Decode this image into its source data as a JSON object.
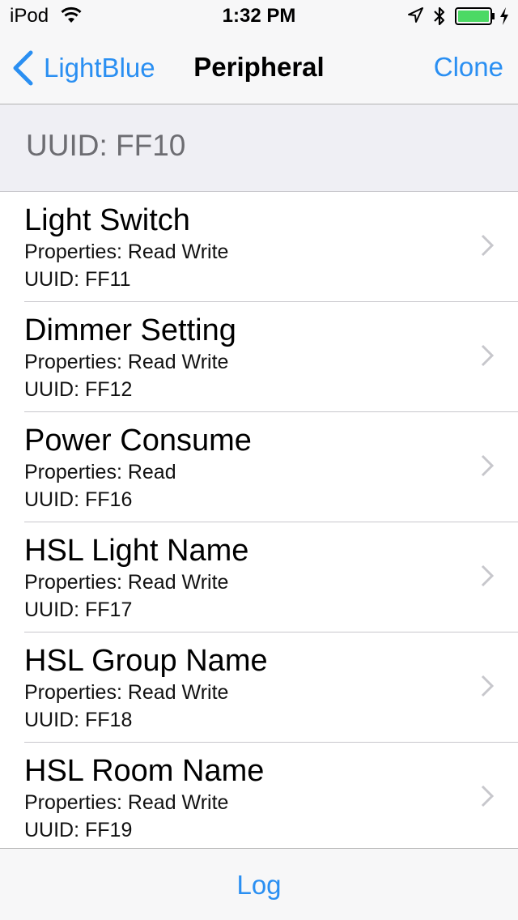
{
  "status_bar": {
    "carrier": "iPod",
    "time": "1:32 PM",
    "battery_color": "#4cd964",
    "wifi_icon": "wifi-icon",
    "location_icon": "location-arrow-icon",
    "bluetooth_icon": "bluetooth-icon",
    "battery_icon": "battery-icon",
    "charging_icon": "charging-bolt-icon"
  },
  "nav": {
    "back_label": "LightBlue",
    "title": "Peripheral",
    "clone_label": "Clone",
    "accent_color": "#2a8ff2"
  },
  "section": {
    "title": "UUID: FF10"
  },
  "characteristics": [
    {
      "name": "Light Switch",
      "properties": "Properties: Read Write",
      "uuid": "UUID: FF11"
    },
    {
      "name": "Dimmer Setting",
      "properties": "Properties: Read Write",
      "uuid": "UUID: FF12"
    },
    {
      "name": "Power Consume",
      "properties": "Properties: Read",
      "uuid": "UUID: FF16"
    },
    {
      "name": "HSL Light Name",
      "properties": "Properties: Read Write",
      "uuid": "UUID: FF17"
    },
    {
      "name": "HSL Group Name",
      "properties": "Properties: Read Write",
      "uuid": "UUID: FF18"
    },
    {
      "name": "HSL Room Name",
      "properties": "Properties: Read Write",
      "uuid": "UUID: FF19"
    }
  ],
  "toolbar": {
    "log_label": "Log"
  }
}
